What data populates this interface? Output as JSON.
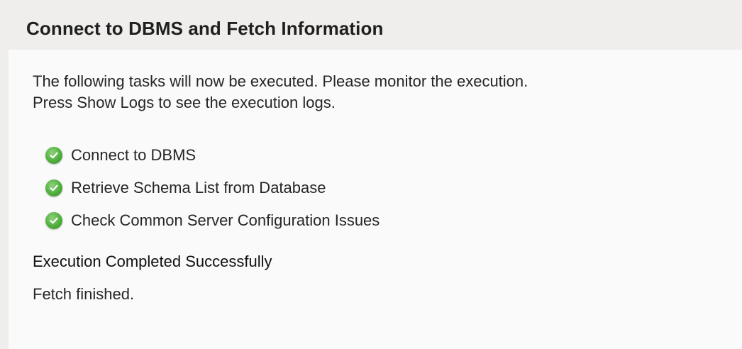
{
  "header": {
    "title": "Connect to DBMS and Fetch Information"
  },
  "intro": {
    "line1": "The following tasks will now be executed. Please monitor the execution.",
    "line2": "Press Show Logs to see the execution logs."
  },
  "tasks": [
    {
      "label": "Connect to DBMS",
      "icon": "check-circle-icon",
      "status": "done"
    },
    {
      "label": "Retrieve Schema List from Database",
      "icon": "check-circle-icon",
      "status": "done"
    },
    {
      "label": "Check Common Server Configuration Issues",
      "icon": "check-circle-icon",
      "status": "done"
    }
  ],
  "status": {
    "summary": "Execution Completed Successfully",
    "detail": "Fetch finished."
  },
  "colors": {
    "success": "#4fae3c",
    "header_bg": "#f0eeec",
    "panel_bg": "#fafafa"
  }
}
